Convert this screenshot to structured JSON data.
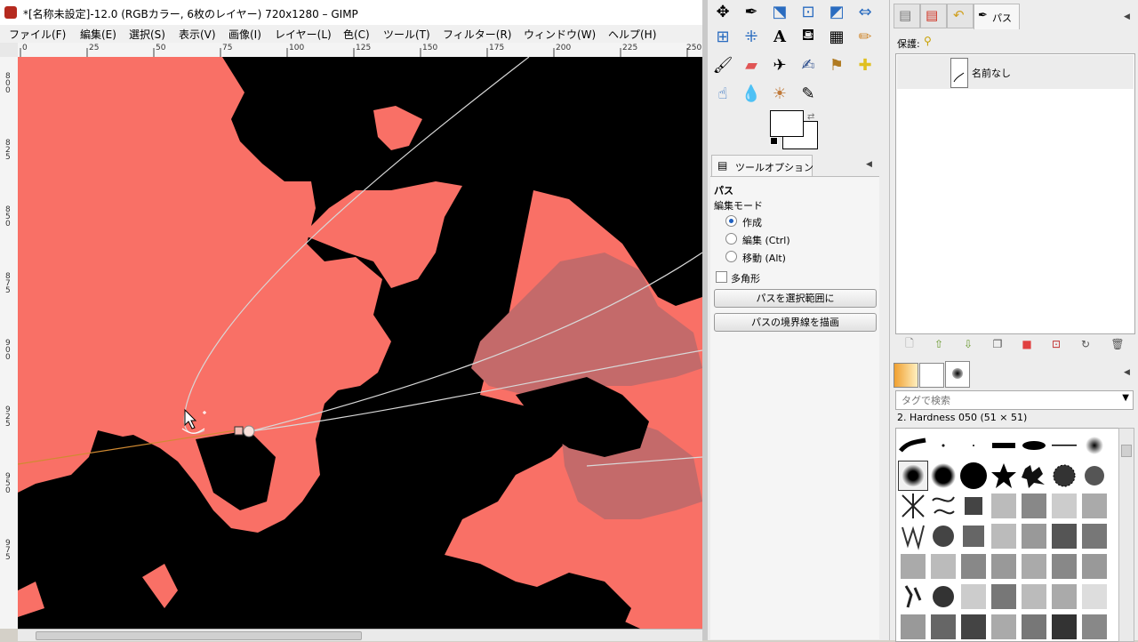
{
  "window": {
    "title": "*[名称未設定]-12.0 (RGBカラー, 6枚のレイヤー) 720x1280 – GIMP"
  },
  "menu": [
    "ファイル(F)",
    "編集(E)",
    "選択(S)",
    "表示(V)",
    "画像(I)",
    "レイヤー(L)",
    "色(C)",
    "ツール(T)",
    "フィルター(R)",
    "ウィンドウ(W)",
    "ヘルプ(H)"
  ],
  "rulers": {
    "horizontal": [
      "0",
      "25",
      "50",
      "75",
      "100",
      "125",
      "150",
      "175",
      "200",
      "225",
      "250"
    ],
    "vertical": [
      "800",
      "825",
      "850",
      "875",
      "900",
      "925",
      "950",
      "975"
    ]
  },
  "toolbox": {
    "tools": [
      "move-tool",
      "paths-tool",
      "transform-tool",
      "crop-tool",
      "perspective-tool",
      "flip-tool",
      "align-tool",
      "cage-tool",
      "text-tool",
      "bucket-fill-tool",
      "blend-tool",
      "pencil-tool",
      "paintbrush-tool",
      "eraser-tool",
      "airbrush-tool",
      "ink-tool",
      "clone-tool",
      "heal-tool",
      "smudge-tool",
      "blur-tool",
      "dodge-tool",
      "color-picker-tool"
    ],
    "fg_color": "#ffffff",
    "bg_color": "#ffffff"
  },
  "tool_options": {
    "tab_label": "ツールオプション",
    "title": "パス",
    "edit_mode_label": "編集モード",
    "modes": [
      "作成",
      "編集 (Ctrl)",
      "移動 (Alt)"
    ],
    "selected_mode": "作成",
    "polygon_label": "多角形",
    "selection_button": "パスを選択範囲に",
    "stroke_button": "パスの境界線を描画"
  },
  "paths_panel": {
    "tab_label": "パス",
    "lock_label": "保護:",
    "paths": [
      {
        "name": "名前なし"
      }
    ]
  },
  "brushes_panel": {
    "tag_search_placeholder": "タグで検索",
    "selected_brush": "2. Hardness 050 (51 × 51)"
  },
  "colors": {
    "canvas_bg": "#000000",
    "salmon": "#f97066",
    "muted_pink": "#c46a6a",
    "path_stroke": "#cfcfcf",
    "accent": "#1e5fbf"
  }
}
